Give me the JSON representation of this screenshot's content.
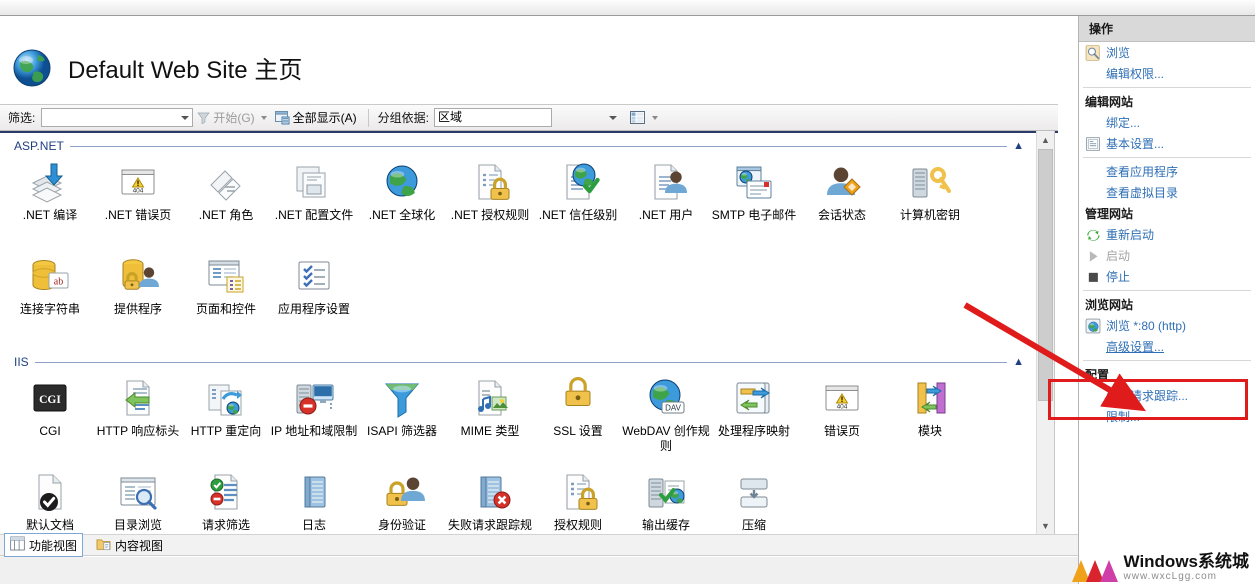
{
  "window": {
    "page_title": "Default Web Site 主页",
    "site_icon": "globe-icon"
  },
  "filter_bar": {
    "filter_label": "筛选:",
    "filter_value": "",
    "filter_placeholder": "",
    "start_button": "开始(G)",
    "show_all_button": "全部显示(A)",
    "group_by_label": "分组依据:",
    "group_by_value": "区域",
    "view_icon": "grid-view-icon"
  },
  "groups": [
    {
      "title": "ASP.NET",
      "collapse_icon": "chevron-up-icon",
      "tiles": [
        {
          "label": ".NET 编译",
          "icon": "net-compilation-icon"
        },
        {
          "label": ".NET 错误页",
          "icon": "net-error-pages-icon"
        },
        {
          "label": ".NET 角色",
          "icon": "net-roles-icon"
        },
        {
          "label": ".NET 配置文件",
          "icon": "net-profile-icon"
        },
        {
          "label": ".NET 全球化",
          "icon": "net-globalization-icon"
        },
        {
          "label": ".NET 授权规则",
          "icon": "net-authorization-rules-icon"
        },
        {
          "label": ".NET 信任级别",
          "icon": "net-trust-levels-icon"
        },
        {
          "label": ".NET 用户",
          "icon": "net-users-icon"
        },
        {
          "label": "SMTP 电子邮件",
          "icon": "smtp-email-icon"
        },
        {
          "label": "会话状态",
          "icon": "session-state-icon"
        },
        {
          "label": "计算机密钥",
          "icon": "machine-key-icon"
        },
        {
          "label": "连接字符串",
          "icon": "connection-strings-icon"
        },
        {
          "label": "提供程序",
          "icon": "providers-icon"
        },
        {
          "label": "页面和控件",
          "icon": "pages-and-controls-icon"
        },
        {
          "label": "应用程序设置",
          "icon": "application-settings-icon"
        }
      ]
    },
    {
      "title": "IIS",
      "collapse_icon": "chevron-up-icon",
      "tiles": [
        {
          "label": "CGI",
          "icon": "cgi-icon"
        },
        {
          "label": "HTTP 响应标头",
          "icon": "http-response-headers-icon"
        },
        {
          "label": "HTTP 重定向",
          "icon": "http-redirect-icon"
        },
        {
          "label": "IP 地址和域限制",
          "icon": "ip-address-domain-restrictions-icon"
        },
        {
          "label": "ISAPI 筛选器",
          "icon": "isapi-filters-icon"
        },
        {
          "label": "MIME 类型",
          "icon": "mime-types-icon"
        },
        {
          "label": "SSL 设置",
          "icon": "ssl-settings-icon"
        },
        {
          "label": "WebDAV 创作规则",
          "icon": "webdav-authoring-rules-icon"
        },
        {
          "label": "处理程序映射",
          "icon": "handler-mappings-icon"
        },
        {
          "label": "错误页",
          "icon": "error-pages-icon"
        },
        {
          "label": "模块",
          "icon": "modules-icon"
        },
        {
          "label": "默认文档",
          "icon": "default-document-icon"
        },
        {
          "label": "目录浏览",
          "icon": "directory-browsing-icon"
        },
        {
          "label": "请求筛选",
          "icon": "request-filtering-icon"
        },
        {
          "label": "日志",
          "icon": "logging-icon"
        },
        {
          "label": "身份验证",
          "icon": "authentication-icon"
        },
        {
          "label": "失败请求跟踪规则",
          "icon": "failed-request-tracing-rules-icon"
        },
        {
          "label": "授权规则",
          "icon": "authorization-rules-icon"
        },
        {
          "label": "输出缓存",
          "icon": "output-caching-icon"
        },
        {
          "label": "压缩",
          "icon": "compression-icon"
        }
      ]
    }
  ],
  "actions_panel": {
    "header": "操作",
    "items": [
      {
        "label": "浏览",
        "icon": "browse-icon",
        "type": "link",
        "state": "enabled"
      },
      {
        "label": "编辑权限...",
        "icon": "",
        "type": "link",
        "state": "enabled"
      },
      {
        "label": "",
        "icon": "",
        "type": "divider",
        "state": ""
      },
      {
        "label": "编辑网站",
        "icon": "",
        "type": "section",
        "state": ""
      },
      {
        "label": "绑定...",
        "icon": "",
        "type": "link",
        "state": "enabled"
      },
      {
        "label": "基本设置...",
        "icon": "basic-settings-icon",
        "type": "link",
        "state": "enabled"
      },
      {
        "label": "",
        "icon": "",
        "type": "divider",
        "state": ""
      },
      {
        "label": "查看应用程序",
        "icon": "",
        "type": "link",
        "state": "enabled"
      },
      {
        "label": "查看虚拟目录",
        "icon": "",
        "type": "link",
        "state": "enabled"
      },
      {
        "label": "管理网站",
        "icon": "",
        "type": "section",
        "state": ""
      },
      {
        "label": "重新启动",
        "icon": "restart-icon",
        "type": "link",
        "state": "enabled"
      },
      {
        "label": "启动",
        "icon": "play-icon",
        "type": "link",
        "state": "disabled"
      },
      {
        "label": "停止",
        "icon": "stop-icon",
        "type": "link",
        "state": "enabled"
      },
      {
        "label": "",
        "icon": "",
        "type": "divider",
        "state": ""
      },
      {
        "label": "浏览网站",
        "icon": "",
        "type": "section",
        "state": ""
      },
      {
        "label": "浏览 *:80 (http)",
        "icon": "browse-site-icon",
        "type": "link",
        "state": "enabled"
      },
      {
        "label": "高级设置...",
        "icon": "",
        "type": "link",
        "state": "enabled"
      },
      {
        "label": "",
        "icon": "",
        "type": "divider",
        "state": ""
      },
      {
        "label": "配置",
        "icon": "",
        "type": "section",
        "state": ""
      },
      {
        "label": "失败请求跟踪...",
        "icon": "",
        "type": "link",
        "state": "enabled"
      },
      {
        "label": "限制...",
        "icon": "",
        "type": "link",
        "state": "enabled"
      }
    ]
  },
  "view_tabs": [
    {
      "label": "功能视图",
      "icon": "features-view-icon",
      "selected": true
    },
    {
      "label": "内容视图",
      "icon": "content-view-icon",
      "selected": false
    }
  ],
  "watermark": {
    "title": "Windows系统城",
    "url": "www.wxcLgg.com"
  },
  "annotation": {
    "highlight_target": "浏览 *:80 (http)",
    "color": "#e01b1b"
  },
  "colors": {
    "link": "#2f6fb5",
    "group_title": "#1f3f84",
    "accent_rule": "#2b3a67",
    "annotation": "#e01b1b"
  }
}
